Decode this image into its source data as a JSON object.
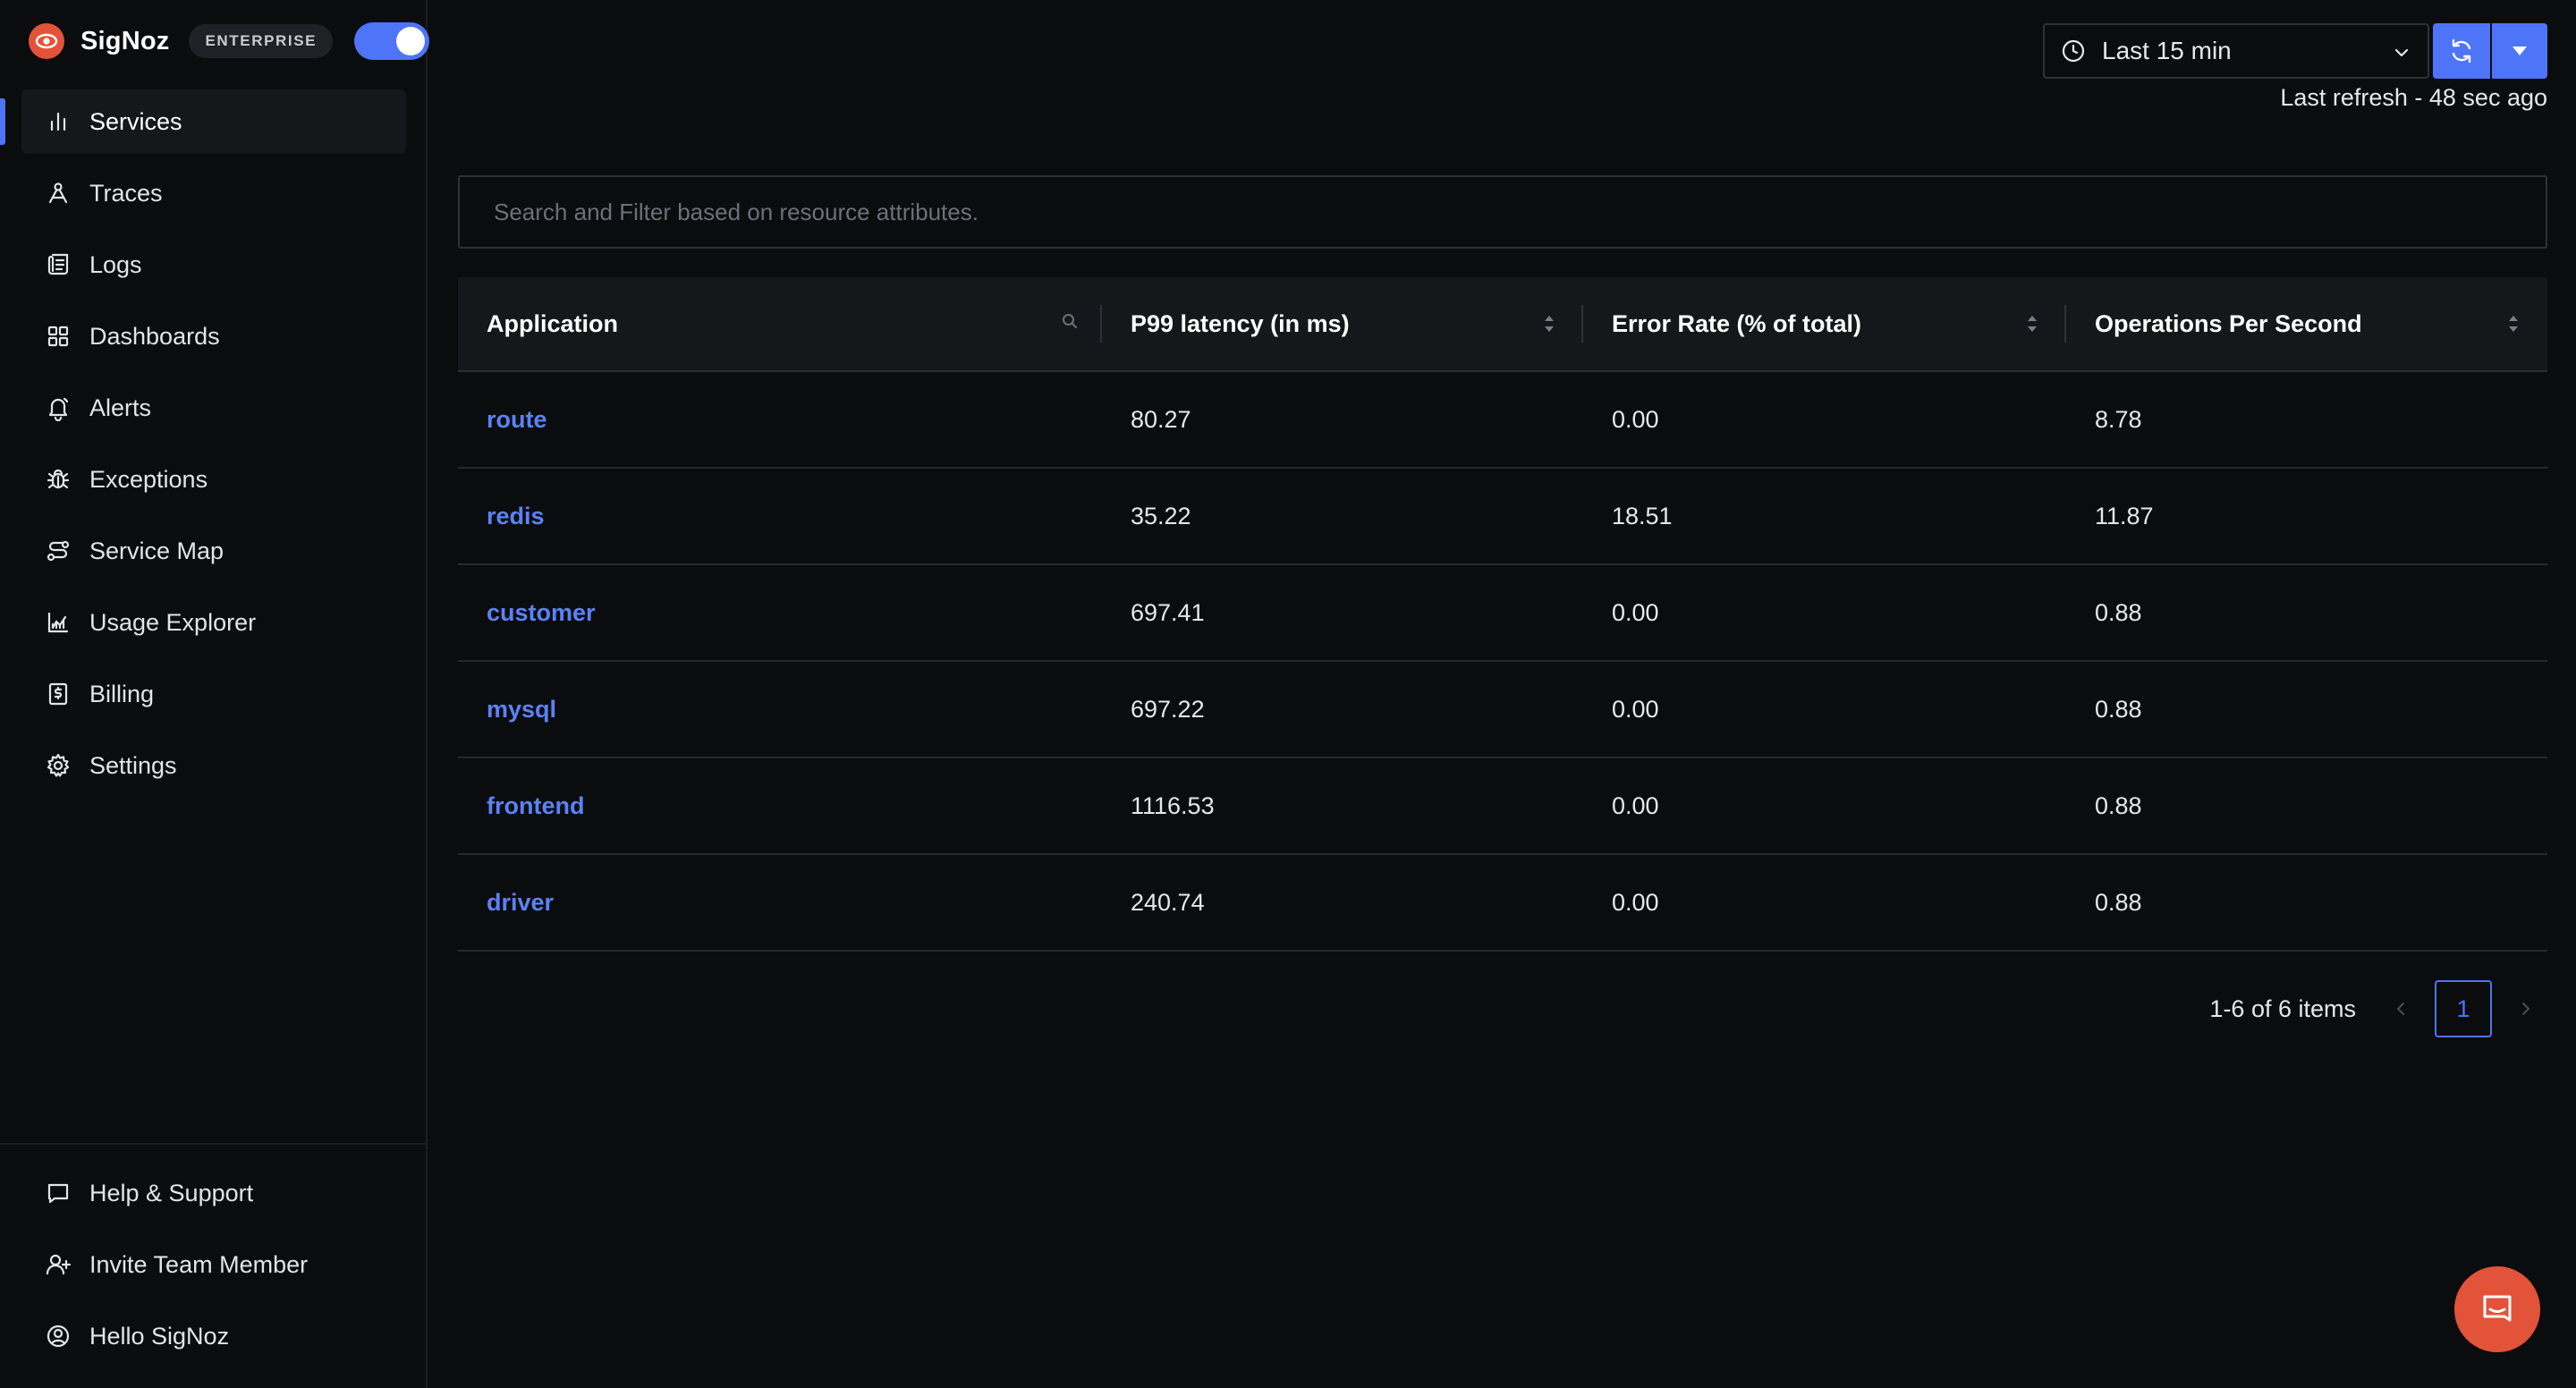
{
  "brand": {
    "name": "SigNoz",
    "badge": "ENTERPRISE"
  },
  "theme_toggle": {
    "state": "dark"
  },
  "sidebar": {
    "items": [
      {
        "label": "Services",
        "icon": "bar-chart-icon",
        "active": true
      },
      {
        "label": "Traces",
        "icon": "traces-icon"
      },
      {
        "label": "Logs",
        "icon": "logs-icon"
      },
      {
        "label": "Dashboards",
        "icon": "dashboard-icon"
      },
      {
        "label": "Alerts",
        "icon": "bell-icon"
      },
      {
        "label": "Exceptions",
        "icon": "bug-icon"
      },
      {
        "label": "Service Map",
        "icon": "route-icon"
      },
      {
        "label": "Usage Explorer",
        "icon": "area-chart-icon"
      },
      {
        "label": "Billing",
        "icon": "receipt-icon"
      },
      {
        "label": "Settings",
        "icon": "gear-icon"
      }
    ],
    "bottom": [
      {
        "label": "Help & Support",
        "icon": "message-icon"
      },
      {
        "label": "Invite Team Member",
        "icon": "user-plus-icon"
      },
      {
        "label": "Hello SigNoz",
        "icon": "user-circle-icon"
      }
    ]
  },
  "header": {
    "time_range": "Last 15 min",
    "last_refresh": "Last refresh - 48 sec ago"
  },
  "search": {
    "placeholder": "Search and Filter based on resource attributes.",
    "value": ""
  },
  "table": {
    "columns": [
      "Application",
      "P99 latency (in ms)",
      "Error Rate (% of total)",
      "Operations Per Second"
    ],
    "rows": [
      {
        "application": "route",
        "p99": "80.27",
        "error_rate": "0.00",
        "ops": "8.78"
      },
      {
        "application": "redis",
        "p99": "35.22",
        "error_rate": "18.51",
        "ops": "11.87"
      },
      {
        "application": "customer",
        "p99": "697.41",
        "error_rate": "0.00",
        "ops": "0.88"
      },
      {
        "application": "mysql",
        "p99": "697.22",
        "error_rate": "0.00",
        "ops": "0.88"
      },
      {
        "application": "frontend",
        "p99": "1116.53",
        "error_rate": "0.00",
        "ops": "0.88"
      },
      {
        "application": "driver",
        "p99": "240.74",
        "error_rate": "0.00",
        "ops": "0.88"
      }
    ]
  },
  "pagination": {
    "total_text": "1-6 of 6 items",
    "current_page": "1"
  },
  "colors": {
    "accent": "#4e74f8",
    "brand": "#e2533a",
    "link": "#5b82f6",
    "background": "#0b0c0e"
  }
}
